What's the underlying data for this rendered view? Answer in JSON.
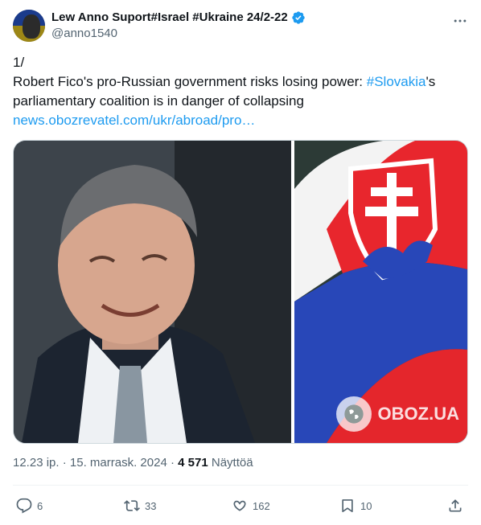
{
  "author": {
    "display_name": "Lew Anno Suport#Israel #Ukraine 24/2-22",
    "handle": "@anno1540",
    "verified": true,
    "verified_color": "#1d9bf0"
  },
  "tweet": {
    "line1": "1/",
    "text_before_hashtag": "Robert Fico's pro-Russian government risks losing power: ",
    "hashtag": "#Slovakia",
    "text_after_hashtag": "'s parliamentary coalition is in danger of collapsing",
    "link": "news.obozrevatel.com/ukr/abroad/pro…"
  },
  "media": {
    "watermark": "OBOZ.UA"
  },
  "meta": {
    "time": "12.23 ip.",
    "separator": " · ",
    "date": "15. marrask. 2024",
    "views_count": "4 571",
    "views_label": "Näyttöä"
  },
  "actions": {
    "replies": "6",
    "retweets": "33",
    "likes": "162",
    "bookmarks": "10"
  },
  "colors": {
    "accent": "#1d9bf0",
    "secondary_text": "#536471"
  }
}
